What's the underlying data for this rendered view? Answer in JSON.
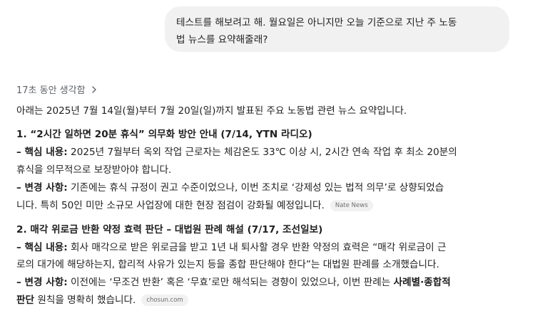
{
  "user_message": {
    "line1": "테스트를 해보려고 해. 월요일은 아니지만 오늘 기준으로 지난 주 노동",
    "line2": "법 뉴스를 요약해줄래?"
  },
  "thought": {
    "label": "17초 동안 생각함"
  },
  "answer": {
    "intro": "아래는 2025년 7월 14일(월)부터 7월 20일(일)까지 발표된 주요 노동법 관련 뉴스 요약입니다.",
    "items": [
      {
        "heading": "1. “2시간 일하면 20분 휴식” 의무화 방안 안내 (7/14, YTN 라디오)",
        "core_label": "– 핵심 내용:",
        "core_line1": " 2025년 7월부터 옥외 작업 근로자는 체감온도 33℃ 이상 시, 2시간 연속 작업 후 최소 20분의",
        "core_line2": "휴식을 의무적으로 보장받아야 합니다.",
        "change_label": "– 변경 사항:",
        "change_line1": " 기존에는 휴식 규정이 권고 수준이었으나, 이번 조치로 ‘강제성 있는 법적 의무’로 상향되었습",
        "change_line2": "니다. 특히 50인 미만 소규모 사업장에 대한 현장 점검이 강화될 예정입니다.",
        "source": "Nate News"
      },
      {
        "heading": "2. 매각 위로금 반환 약정 효력 판단 – 대법원 판례 해설 (7/17, 조선일보)",
        "core_label": "– 핵심 내용:",
        "core_line1": " 회사 매각으로 받은 위로금을 받고 1년 내 퇴사할 경우 반환 약정의 효력은 “매각 위로금이 근",
        "core_line2": "로의 대가에 해당하는지, 합리적 사유가 있는지 등을 종합 판단해야 한다”는 대법원 판례를 소개했습니다.",
        "change_label": "– 변경 사항:",
        "change_line1a": " 이전에는 ‘무조건 반환’ 혹은 ‘무효’로만 해석되는 경향이 있었으나, 이번 판례는 ",
        "change_line1b": "사례별·종합적",
        "change_line2a": "판단",
        "change_line2b": " 원칙을 명확히 했습니다.",
        "source": "chosun.com"
      }
    ]
  }
}
